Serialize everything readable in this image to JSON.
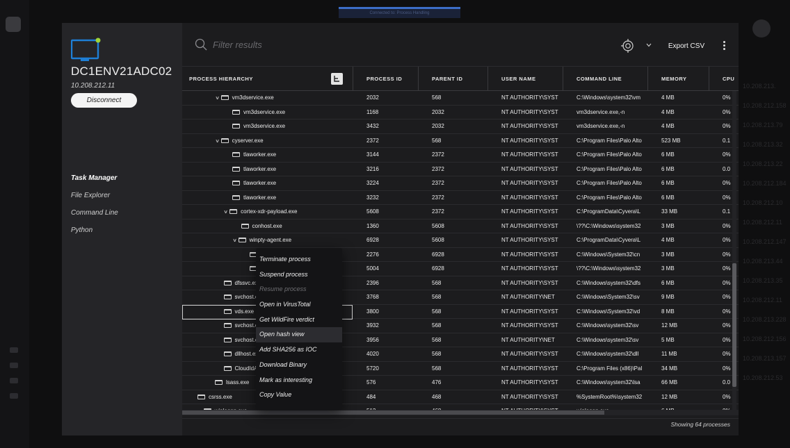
{
  "backdrop": {
    "banner": "Connected to: Process Handling",
    "right_list": [
      "10.208.213.",
      "10.208.212.158",
      "10.208.213.79",
      "10.208.213.32",
      "10.208.213.22",
      "10.208.212.184",
      "10.208.212.10",
      "10.208.212.11",
      "10.208.212.147",
      "10.208.213.44",
      "10.208.213.35",
      "10.208.212.11",
      "10.208.213.228",
      "10.208.212.156",
      "10.208.213.157",
      "10.208.212.53"
    ]
  },
  "endpoint": {
    "hostname": "DC1ENV21ADC02",
    "ip": "10.208.212.11",
    "disconnect_label": "Disconnect",
    "status_color": "#9fd43a",
    "monitor_color": "#1e7fd6"
  },
  "nav": {
    "items": [
      "Task Manager",
      "File Explorer",
      "Command Line",
      "Python"
    ],
    "active": "Task Manager"
  },
  "toolbar": {
    "search_placeholder": "Filter results",
    "export_label": "Export CSV"
  },
  "table": {
    "columns": [
      "PROCESS HIERARCHY",
      "PROCESS ID",
      "PARENT ID",
      "USER NAME",
      "COMMAND LINE",
      "MEMORY",
      "CPU"
    ],
    "rows": [
      {
        "name": "vm3dservice.exe",
        "level": 3,
        "expanded": true,
        "pid": "2032",
        "ppid": "568",
        "user": "NT AUTHORITY\\SYST",
        "cmd": "C:\\Windows\\system32\\vm",
        "mem": "4 MB",
        "cpu": "0%"
      },
      {
        "name": "vm3dservice.exe",
        "level": 4,
        "expanded": false,
        "pid": "1168",
        "ppid": "2032",
        "user": "NT AUTHORITY\\SYST",
        "cmd": "vm3dservice.exe,-n",
        "mem": "4 MB",
        "cpu": "0%"
      },
      {
        "name": "vm3dservice.exe",
        "level": 4,
        "expanded": false,
        "pid": "3432",
        "ppid": "2032",
        "user": "NT AUTHORITY\\SYST",
        "cmd": "vm3dservice.exe,-n",
        "mem": "4 MB",
        "cpu": "0%"
      },
      {
        "name": "cyserver.exe",
        "level": 3,
        "expanded": true,
        "pid": "2372",
        "ppid": "568",
        "user": "NT AUTHORITY\\SYST",
        "cmd": "C:\\Program Files\\Palo Alto",
        "mem": "523 MB",
        "cpu": "0.1"
      },
      {
        "name": "tlaworker.exe",
        "level": 4,
        "expanded": false,
        "pid": "3144",
        "ppid": "2372",
        "user": "NT AUTHORITY\\SYST",
        "cmd": "C:\\Program Files\\Palo Alto",
        "mem": "6 MB",
        "cpu": "0%"
      },
      {
        "name": "tlaworker.exe",
        "level": 4,
        "expanded": false,
        "pid": "3216",
        "ppid": "2372",
        "user": "NT AUTHORITY\\SYST",
        "cmd": "C:\\Program Files\\Palo Alto",
        "mem": "6 MB",
        "cpu": "0.0"
      },
      {
        "name": "tlaworker.exe",
        "level": 4,
        "expanded": false,
        "pid": "3224",
        "ppid": "2372",
        "user": "NT AUTHORITY\\SYST",
        "cmd": "C:\\Program Files\\Palo Alto",
        "mem": "6 MB",
        "cpu": "0%"
      },
      {
        "name": "tlaworker.exe",
        "level": 4,
        "expanded": false,
        "pid": "3232",
        "ppid": "2372",
        "user": "NT AUTHORITY\\SYST",
        "cmd": "C:\\Program Files\\Palo Alto",
        "mem": "6 MB",
        "cpu": "0%"
      },
      {
        "name": "cortex-xdr-payload.exe",
        "level": 4,
        "expanded": true,
        "pid": "5608",
        "ppid": "2372",
        "user": "NT AUTHORITY\\SYST",
        "cmd": "C:\\ProgramData\\Cyvera\\L",
        "mem": "33 MB",
        "cpu": "0.1"
      },
      {
        "name": "conhost.exe",
        "level": 5,
        "expanded": false,
        "pid": "1360",
        "ppid": "5608",
        "user": "NT AUTHORITY\\SYST",
        "cmd": "\\??\\C:\\Windows\\system32",
        "mem": "3 MB",
        "cpu": "0%"
      },
      {
        "name": "winpty-agent.exe",
        "level": 5,
        "expanded": true,
        "pid": "6928",
        "ppid": "5608",
        "user": "NT AUTHORITY\\SYST",
        "cmd": "C:\\ProgramData\\Cyvera\\L",
        "mem": "4 MB",
        "cpu": "0%"
      },
      {
        "name": "cmd.exe",
        "level": 6,
        "expanded": false,
        "pid": "2276",
        "ppid": "6928",
        "user": "NT AUTHORITY\\SYST",
        "cmd": "C:\\Windows\\System32\\cn",
        "mem": "3 MB",
        "cpu": "0%"
      },
      {
        "name": "conhost.exe",
        "level": 6,
        "expanded": false,
        "pid": "5004",
        "ppid": "6928",
        "user": "NT AUTHORITY\\SYST",
        "cmd": "\\??\\C:\\Windows\\system32",
        "mem": "3 MB",
        "cpu": "0%"
      },
      {
        "name": "dfssvc.exe",
        "level": 3,
        "expanded": false,
        "pid": "2396",
        "ppid": "568",
        "user": "NT AUTHORITY\\SYST",
        "cmd": "C:\\Windows\\system32\\dfs",
        "mem": "6 MB",
        "cpu": "0%"
      },
      {
        "name": "svchost.exe",
        "level": 3,
        "expanded": false,
        "pid": "3768",
        "ppid": "568",
        "user": "NT AUTHORITY\\NET",
        "cmd": "C:\\Windows\\System32\\sv",
        "mem": "9 MB",
        "cpu": "0%"
      },
      {
        "name": "vds.exe",
        "level": 3,
        "expanded": false,
        "pid": "3800",
        "ppid": "568",
        "user": "NT AUTHORITY\\SYST",
        "cmd": "C:\\Windows\\System32\\vd",
        "mem": "8 MB",
        "cpu": "0%",
        "selected": true
      },
      {
        "name": "svchost.exe",
        "level": 3,
        "expanded": false,
        "pid": "3932",
        "ppid": "568",
        "user": "NT AUTHORITY\\SYST",
        "cmd": "C:\\Windows\\system32\\sv",
        "mem": "12 MB",
        "cpu": "0%"
      },
      {
        "name": "svchost.exe",
        "level": 3,
        "expanded": false,
        "pid": "3956",
        "ppid": "568",
        "user": "NT AUTHORITY\\NET",
        "cmd": "C:\\Windows\\system32\\sv",
        "mem": "5 MB",
        "cpu": "0%"
      },
      {
        "name": "dllhost.exe",
        "level": 3,
        "expanded": false,
        "pid": "4020",
        "ppid": "568",
        "user": "NT AUTHORITY\\SYST",
        "cmd": "C:\\Windows\\system32\\dll",
        "mem": "11 MB",
        "cpu": "0%"
      },
      {
        "name": "CloudIdAgent.exe",
        "level": 3,
        "expanded": false,
        "pid": "5720",
        "ppid": "568",
        "user": "NT AUTHORITY\\SYST",
        "cmd": "C:\\Program Files (x86)\\Pal",
        "mem": "34 MB",
        "cpu": "0%"
      },
      {
        "name": "lsass.exe",
        "level": 2,
        "expanded": false,
        "pid": "576",
        "ppid": "476",
        "user": "NT AUTHORITY\\SYST",
        "cmd": "C:\\Windows\\system32\\lsa",
        "mem": "66 MB",
        "cpu": "0.0"
      },
      {
        "name": "csrss.exe",
        "level": 0,
        "expanded": false,
        "pid": "484",
        "ppid": "468",
        "user": "NT AUTHORITY\\SYST",
        "cmd": "%SystemRoot%\\system32",
        "mem": "12 MB",
        "cpu": "0%"
      },
      {
        "name": "winlogon.exe",
        "level": 1,
        "expanded": true,
        "pid": "512",
        "ppid": "468",
        "user": "NT AUTHORITY\\SYST",
        "cmd": "winlogon.exe",
        "mem": "6 MB",
        "cpu": "0%"
      }
    ],
    "status": "Showing 64 processes"
  },
  "context_menu": {
    "items": [
      {
        "label": "Terminate process",
        "disabled": false
      },
      {
        "label": "Suspend process",
        "disabled": false
      },
      {
        "label": "Resume process",
        "disabled": true
      },
      {
        "label": "Open in VirusTotal",
        "disabled": false
      },
      {
        "label": "Get WildFire verdict",
        "disabled": false
      },
      {
        "label": "Open hash view",
        "disabled": false,
        "hover": true
      },
      {
        "label": "Add SHA256 as IOC",
        "disabled": false
      },
      {
        "label": "Download Binary",
        "disabled": false
      },
      {
        "label": "Mark as interesting",
        "disabled": false
      },
      {
        "label": "Copy Value",
        "disabled": false
      }
    ]
  }
}
